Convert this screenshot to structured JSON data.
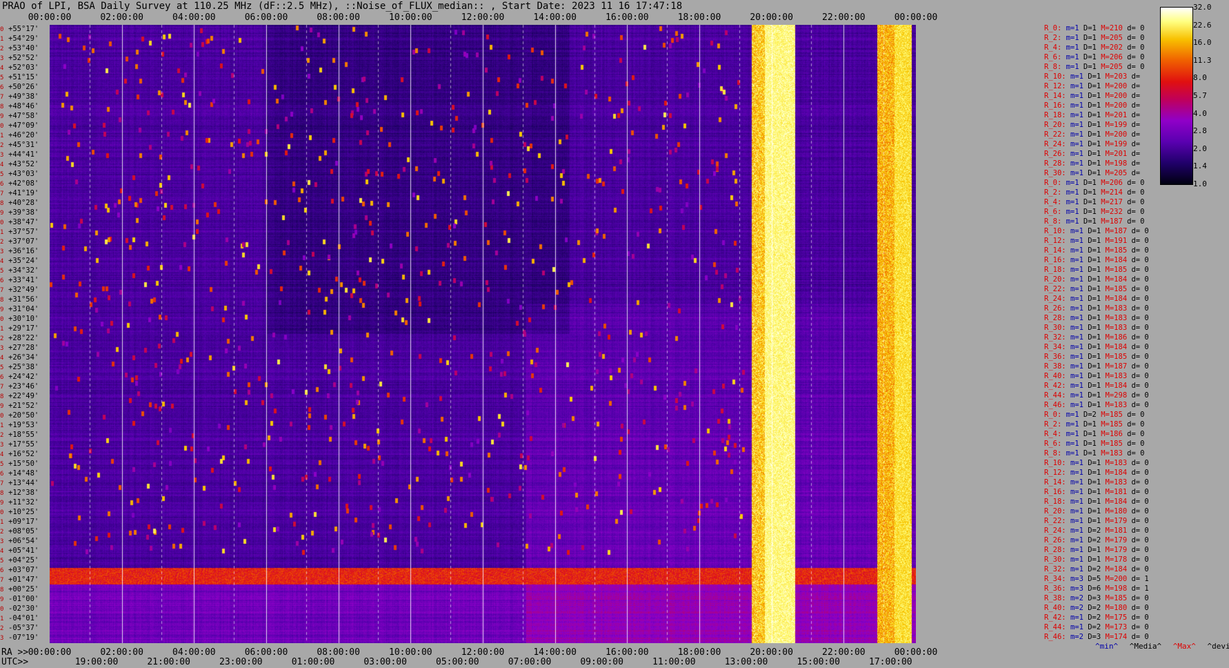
{
  "title": "PRAO of LPI, BSA Daily Survey at 110.25 MHz (dF::2.5 MHz), ::Noise_of_FLUX_median:: , Start Date: 2023 11 16 17:47:18",
  "ra_prefix": "RA >>",
  "utc_prefix": "UTC>>",
  "ra_ticks": [
    "00:00:00",
    "02:00:00",
    "04:00:00",
    "06:00:00",
    "08:00:00",
    "10:00:00",
    "12:00:00",
    "14:00:00",
    "16:00:00",
    "18:00:00",
    "20:00:00",
    "22:00:00",
    "00:00:00"
  ],
  "utc_ticks": [
    "19:00:00",
    "21:00:00",
    "23:00:00",
    "01:00:00",
    "03:00:00",
    "05:00:00",
    "07:00:00",
    "09:00:00",
    "11:00:00",
    "13:00:00",
    "15:00:00",
    "17:00:00"
  ],
  "declinations": [
    "+55°17'",
    "+54°29'",
    "+53°40'",
    "+52°52'",
    "+52°03'",
    "+51°15'",
    "+50°26'",
    "+49°38'",
    "+48°46'",
    "+47°58'",
    "+47°09'",
    "+46°20'",
    "+45°31'",
    "+44°41'",
    "+43°52'",
    "+43°03'",
    "+42°08'",
    "+41°19'",
    "+40°28'",
    "+39°38'",
    "+38°47'",
    "+37°57'",
    "+37°07'",
    "+36°16'",
    "+35°24'",
    "+34°32'",
    "+33°41'",
    "+32°49'",
    "+31°56'",
    "+31°04'",
    "+30°10'",
    "+29°17'",
    "+28°22'",
    "+27°28'",
    "+26°34'",
    "+25°38'",
    "+24°42'",
    "+23°46'",
    "+22°49'",
    "+21°52'",
    "+20°50'",
    "+19°53'",
    "+18°55'",
    "+17°55'",
    "+16°52'",
    "+15°50'",
    "+14°48'",
    "+13°44'",
    "+12°38'",
    "+11°32'",
    "+10°25'",
    "+09°17'",
    "+08°05'",
    "+06°54'",
    "+05°41'",
    "+04°25'",
    "+03°07'",
    "+01°47'",
    "+00°25'",
    "-01°00'",
    "-02°30'",
    "-04°01'",
    "-05°37'",
    "-07°19'"
  ],
  "stats": [
    {
      "r": "R_0:",
      "m": "m=1",
      "d": "D=1",
      "M": "M=210",
      "dv": "d= 0"
    },
    {
      "r": "R_2:",
      "m": "m=1",
      "d": "D=1",
      "M": "M=205",
      "dv": "d= 0"
    },
    {
      "r": "R_4:",
      "m": "m=1",
      "d": "D=1",
      "M": "M=202",
      "dv": "d= 0"
    },
    {
      "r": "R_6:",
      "m": "m=1",
      "d": "D=1",
      "M": "M=206",
      "dv": "d= 0"
    },
    {
      "r": "R_8:",
      "m": "m=1",
      "d": "D=1",
      "M": "M=205",
      "dv": "d= 0"
    },
    {
      "r": "R_10:",
      "m": "m=1",
      "d": "D=1",
      "M": "M=203",
      "dv": "d="
    },
    {
      "r": "R_12:",
      "m": "m=1",
      "d": "D=1",
      "M": "M=200",
      "dv": "d="
    },
    {
      "r": "R_14:",
      "m": "m=1",
      "d": "D=1",
      "M": "M=200",
      "dv": "d="
    },
    {
      "r": "R_16:",
      "m": "m=1",
      "d": "D=1",
      "M": "M=200",
      "dv": "d="
    },
    {
      "r": "R_18:",
      "m": "m=1",
      "d": "D=1",
      "M": "M=201",
      "dv": "d="
    },
    {
      "r": "R_20:",
      "m": "m=1",
      "d": "D=1",
      "M": "M=199",
      "dv": "d="
    },
    {
      "r": "R_22:",
      "m": "m=1",
      "d": "D=1",
      "M": "M=200",
      "dv": "d="
    },
    {
      "r": "R_24:",
      "m": "m=1",
      "d": "D=1",
      "M": "M=199",
      "dv": "d="
    },
    {
      "r": "R_26:",
      "m": "m=1",
      "d": "D=1",
      "M": "M=201",
      "dv": "d="
    },
    {
      "r": "R_28:",
      "m": "m=1",
      "d": "D=1",
      "M": "M=198",
      "dv": "d="
    },
    {
      "r": "R_30:",
      "m": "m=1",
      "d": "D=1",
      "M": "M=205",
      "dv": "d="
    },
    {
      "r": "R_0:",
      "m": "m=1",
      "d": "D=1",
      "M": "M=206",
      "dv": "d= 0"
    },
    {
      "r": "R_2:",
      "m": "m=1",
      "d": "D=1",
      "M": "M=214",
      "dv": "d= 0"
    },
    {
      "r": "R_4:",
      "m": "m=1",
      "d": "D=1",
      "M": "M=217",
      "dv": "d= 0"
    },
    {
      "r": "R_6:",
      "m": "m=1",
      "d": "D=1",
      "M": "M=232",
      "dv": "d= 0"
    },
    {
      "r": "R_8:",
      "m": "m=1",
      "d": "D=1",
      "M": "M=187",
      "dv": "d= 0"
    },
    {
      "r": "R_10:",
      "m": "m=1",
      "d": "D=1",
      "M": "M=187",
      "dv": "d= 0"
    },
    {
      "r": "R_12:",
      "m": "m=1",
      "d": "D=1",
      "M": "M=191",
      "dv": "d= 0"
    },
    {
      "r": "R_14:",
      "m": "m=1",
      "d": "D=1",
      "M": "M=185",
      "dv": "d= 0"
    },
    {
      "r": "R_16:",
      "m": "m=1",
      "d": "D=1",
      "M": "M=184",
      "dv": "d= 0"
    },
    {
      "r": "R_18:",
      "m": "m=1",
      "d": "D=1",
      "M": "M=185",
      "dv": "d= 0"
    },
    {
      "r": "R_20:",
      "m": "m=1",
      "d": "D=1",
      "M": "M=184",
      "dv": "d= 0"
    },
    {
      "r": "R_22:",
      "m": "m=1",
      "d": "D=1",
      "M": "M=185",
      "dv": "d= 0"
    },
    {
      "r": "R_24:",
      "m": "m=1",
      "d": "D=1",
      "M": "M=184",
      "dv": "d= 0"
    },
    {
      "r": "R_26:",
      "m": "m=1",
      "d": "D=1",
      "M": "M=183",
      "dv": "d= 0"
    },
    {
      "r": "R_28:",
      "m": "m=1",
      "d": "D=1",
      "M": "M=183",
      "dv": "d= 0"
    },
    {
      "r": "R_30:",
      "m": "m=1",
      "d": "D=1",
      "M": "M=183",
      "dv": "d= 0"
    },
    {
      "r": "R_32:",
      "m": "m=1",
      "d": "D=1",
      "M": "M=186",
      "dv": "d= 0"
    },
    {
      "r": "R_34:",
      "m": "m=1",
      "d": "D=1",
      "M": "M=184",
      "dv": "d= 0"
    },
    {
      "r": "R_36:",
      "m": "m=1",
      "d": "D=1",
      "M": "M=185",
      "dv": "d= 0"
    },
    {
      "r": "R_38:",
      "m": "m=1",
      "d": "D=1",
      "M": "M=187",
      "dv": "d= 0"
    },
    {
      "r": "R_40:",
      "m": "m=1",
      "d": "D=1",
      "M": "M=183",
      "dv": "d= 0"
    },
    {
      "r": "R_42:",
      "m": "m=1",
      "d": "D=1",
      "M": "M=184",
      "dv": "d= 0"
    },
    {
      "r": "R_44:",
      "m": "m=1",
      "d": "D=1",
      "M": "M=298",
      "dv": "d= 0"
    },
    {
      "r": "R_46:",
      "m": "m=1",
      "d": "D=1",
      "M": "M=183",
      "dv": "d= 0"
    },
    {
      "r": "R_0:",
      "m": "m=1",
      "d": "D=2",
      "M": "M=185",
      "dv": "d= 0"
    },
    {
      "r": "R_2:",
      "m": "m=1",
      "d": "D=1",
      "M": "M=185",
      "dv": "d= 0"
    },
    {
      "r": "R_4:",
      "m": "m=1",
      "d": "D=1",
      "M": "M=186",
      "dv": "d= 0"
    },
    {
      "r": "R_6:",
      "m": "m=1",
      "d": "D=1",
      "M": "M=185",
      "dv": "d= 0"
    },
    {
      "r": "R_8:",
      "m": "m=1",
      "d": "D=1",
      "M": "M=183",
      "dv": "d= 0"
    },
    {
      "r": "R_10:",
      "m": "m=1",
      "d": "D=1",
      "M": "M=183",
      "dv": "d= 0"
    },
    {
      "r": "R_12:",
      "m": "m=1",
      "d": "D=1",
      "M": "M=184",
      "dv": "d= 0"
    },
    {
      "r": "R_14:",
      "m": "m=1",
      "d": "D=1",
      "M": "M=183",
      "dv": "d= 0"
    },
    {
      "r": "R_16:",
      "m": "m=1",
      "d": "D=1",
      "M": "M=181",
      "dv": "d= 0"
    },
    {
      "r": "R_18:",
      "m": "m=1",
      "d": "D=1",
      "M": "M=184",
      "dv": "d= 0"
    },
    {
      "r": "R_20:",
      "m": "m=1",
      "d": "D=1",
      "M": "M=180",
      "dv": "d= 0"
    },
    {
      "r": "R_22:",
      "m": "m=1",
      "d": "D=1",
      "M": "M=179",
      "dv": "d= 0"
    },
    {
      "r": "R_24:",
      "m": "m=1",
      "d": "D=2",
      "M": "M=181",
      "dv": "d= 0"
    },
    {
      "r": "R_26:",
      "m": "m=1",
      "d": "D=2",
      "M": "M=179",
      "dv": "d= 0"
    },
    {
      "r": "R_28:",
      "m": "m=1",
      "d": "D=1",
      "M": "M=179",
      "dv": "d= 0"
    },
    {
      "r": "R_30:",
      "m": "m=1",
      "d": "D=1",
      "M": "M=178",
      "dv": "d= 0"
    },
    {
      "r": "R_32:",
      "m": "m=1",
      "d": "D=2",
      "M": "M=184",
      "dv": "d= 0"
    },
    {
      "r": "R_34:",
      "m": "m=3",
      "d": "D=5",
      "M": "M=200",
      "dv": "d= 1"
    },
    {
      "r": "R_36:",
      "m": "m=3",
      "d": "D=6",
      "M": "M=198",
      "dv": "d= 1"
    },
    {
      "r": "R_38:",
      "m": "m=2",
      "d": "D=3",
      "M": "M=185",
      "dv": "d= 0"
    },
    {
      "r": "R_40:",
      "m": "m=2",
      "d": "D=2",
      "M": "M=180",
      "dv": "d= 0"
    },
    {
      "r": "R_42:",
      "m": "m=1",
      "d": "D=2",
      "M": "M=175",
      "dv": "d= 0"
    },
    {
      "r": "R_44:",
      "m": "m=1",
      "d": "D=2",
      "M": "M=173",
      "dv": "d= 0"
    },
    {
      "r": "R_46:",
      "m": "m=2",
      "d": "D=3",
      "M": "M=174",
      "dv": "d= 0"
    }
  ],
  "legend_keys": {
    "min": "^min^",
    "media": "^Media^",
    "max": "^Max^",
    "devia": "^devia^"
  },
  "colorbar": {
    "ticks": [
      "32.0",
      "22.6",
      "16.0",
      "11.3",
      "8.0",
      "5.7",
      "4.0",
      "2.8",
      "2.0",
      "1.4",
      "1.0"
    ],
    "colors": [
      "#000010",
      "#20006a",
      "#5a00b0",
      "#9000c8",
      "#c0005a",
      "#e01010",
      "#f06000",
      "#f8c000",
      "#ffff80",
      "#ffffff"
    ]
  },
  "chart_data": {
    "type": "heatmap",
    "title": "PRAO of LPI, BSA Daily Survey at 110.25 MHz (dF::2.5 MHz), ::Noise_of_FLUX_median:: , Start Date: 2023 11 16 17:47:18",
    "x_axis_top": "RA 00:00:00 - 24:00:00",
    "x_axis_bottom": "UTC 19:00:00 - 17:00:00",
    "y_axis": "Declination +55°17' to -07°19'",
    "colorscale_range": [
      1.0,
      32.0
    ],
    "features": [
      {
        "label": "bright horizontal band",
        "dec": "+01°47' to +00°25'",
        "level": 8.0
      },
      {
        "label": "saturated vertical stripe",
        "ra": "~19:30 - 20:20",
        "level": 32.0
      },
      {
        "label": "saturated vertical stripe",
        "ra": "~23:10 - 23:50",
        "level": 16.0
      }
    ]
  }
}
